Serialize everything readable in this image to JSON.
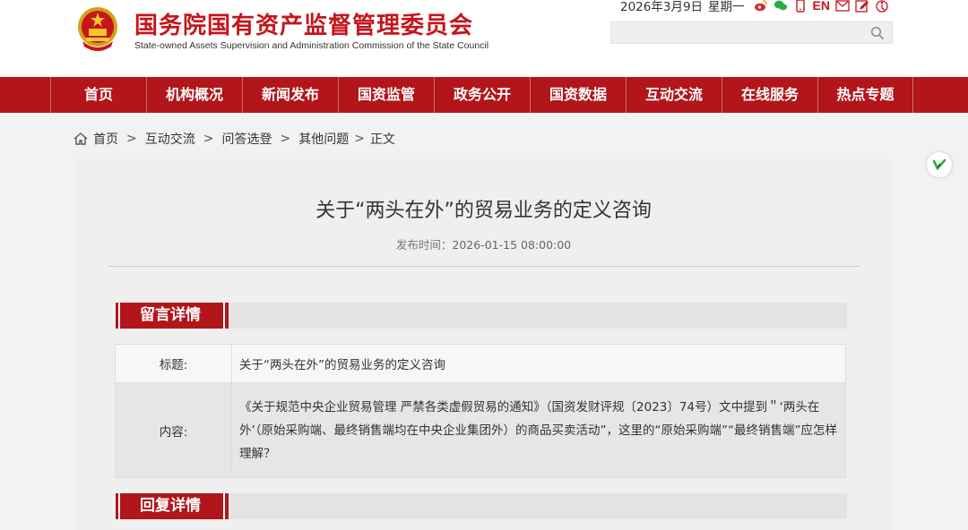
{
  "header": {
    "logo_cn": "国务院国有资产监督管理委员会",
    "logo_en": "State-owned Assets Supervision and Administration Commission of the State Council",
    "date": "2026年3月9日",
    "weekday": "星期一",
    "en_link": "EN",
    "search_placeholder": ""
  },
  "top_icons": [
    "weibo-icon",
    "wechat-icon",
    "mobile-icon",
    "en-link",
    "mail-icon",
    "edit-icon",
    "accessibility-icon"
  ],
  "nav": {
    "items": [
      {
        "label": "首页"
      },
      {
        "label": "机构概况"
      },
      {
        "label": "新闻发布"
      },
      {
        "label": "国资监管"
      },
      {
        "label": "政务公开"
      },
      {
        "label": "国资数据"
      },
      {
        "label": "互动交流"
      },
      {
        "label": "在线服务"
      },
      {
        "label": "热点专题"
      }
    ]
  },
  "breadcrumb": {
    "home": "首页",
    "sep": ">",
    "items": [
      "互动交流",
      "问答选登",
      "其他问题"
    ],
    "current": "正文"
  },
  "article": {
    "title": "关于“两头在外”的贸易业务的定义咨询",
    "pub_label": "发布时间：",
    "pub_time": "2026-01-15 08:00:00"
  },
  "message": {
    "section_title": "留言详情",
    "title_label": "标题:",
    "title_value": "关于“两头在外”的贸易业务的定义咨询",
    "content_label": "内容:",
    "content_value": "《关于规范中央企业贸易管理 严禁各类虚假贸易的通知》（国资发财评规〔2023〕74号）文中提到＂‘两头在外’（原始采购端、最终销售端均在中央企业集团外）的商品买卖活动”，这里的“原始采购端”“最终销售端”应怎样理解？"
  },
  "reply": {
    "section_title": "回复详情"
  },
  "colors": {
    "brand_red": "#b2151a",
    "logo_red": "#c4161c",
    "panel_bg": "#efefef"
  }
}
